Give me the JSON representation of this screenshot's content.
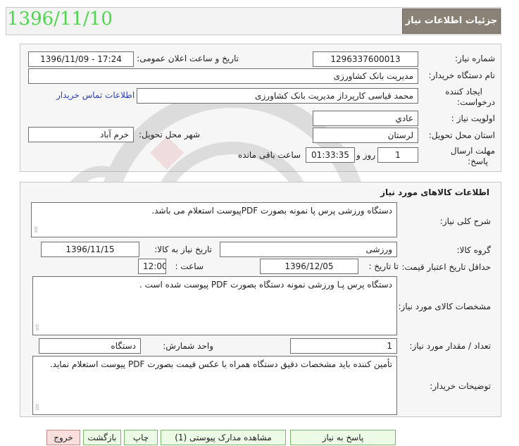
{
  "stamp_date": "1396/11/10",
  "header": {
    "title": "جزئیات اطلاعات نیاز"
  },
  "details": {
    "need_number_label": "شماره نیاز:",
    "need_number": "1296337600013",
    "announce_label": "تاریخ و ساعت اعلان عمومی:",
    "announce_value": "1396/11/09 - 17:24",
    "buyer_label": "نام دستگاه خریدار:",
    "buyer_value": "مدیریت بانک کشاورزی",
    "creator_label_1": "ایجاد کننده",
    "creator_label_2": "درخواست:",
    "creator_value": "محمد قیاسی کارپرداز مدیریت بانک کشاورزی",
    "contact_link": "اطلاعات تماس خریدار",
    "priority_label": "اولویت نیاز :",
    "priority_value": "عادي",
    "province_label": "استان محل تحویل:",
    "province_value": "لرستان",
    "city_label": "شهر محل تحویل:",
    "city_value": "خرم آباد",
    "deadline_label_1": "مهلت ارسال",
    "deadline_label_2": "پاسخ:",
    "deadline_days": "1",
    "deadline_day_word": "روز و",
    "deadline_time": "01:33:35",
    "deadline_remaining": "ساعت باقی مانده"
  },
  "goods": {
    "section_title": "اطلاعات کالاهای مورد نیاز",
    "general_desc_label": "شرح کلی نیاز:",
    "general_desc": "دستگاه ورزشی پرس پا نمونه بصورت PDFپیوست استعلام می باشد.",
    "group_label": "گروه کالا:",
    "group_value": "ورزشی",
    "need_date_label": "تاریخ نیاز به کالا:",
    "need_date": "1396/11/15",
    "min_validity_label": "حداقل تاریخ اعتبار قیمت:",
    "until_date_label": "تا تاریخ :",
    "until_date": "1396/12/05",
    "time_label": "ساعت :",
    "time_value": "12:00",
    "specs_label": "مشخصات کالای مورد نیاز:",
    "specs_value": "دستگاه پرس پـا ورزشی نمونه دستگاه بصورت PDF پیوست شده است .",
    "qty_label": "تعداد / مقدار مورد نیاز:",
    "qty_value": "1",
    "unit_label": "واحد شمارش:",
    "unit_value": "دستگاه",
    "buyer_notes_label": "توضیحات خریدار:",
    "buyer_notes": "تأمین کننده باید مشخصات دقیق دستگاه همراه با عکس قیمت بصورت PDF پیوست استعلام نماید."
  },
  "footer": {
    "reply_button": "پاسخ به نیاز",
    "attachments_button": "مشاهده مدارک پیوستی (1)",
    "print_button": "چاپ",
    "back_button": "بازگشت",
    "exit_button": "خروج"
  },
  "colors": {
    "header_bg": "#8b8277",
    "stamp": "#4cd74c",
    "link": "#2a3fb5",
    "button_bg": "#ecfbe6",
    "exit_bg": "#f9dede"
  }
}
